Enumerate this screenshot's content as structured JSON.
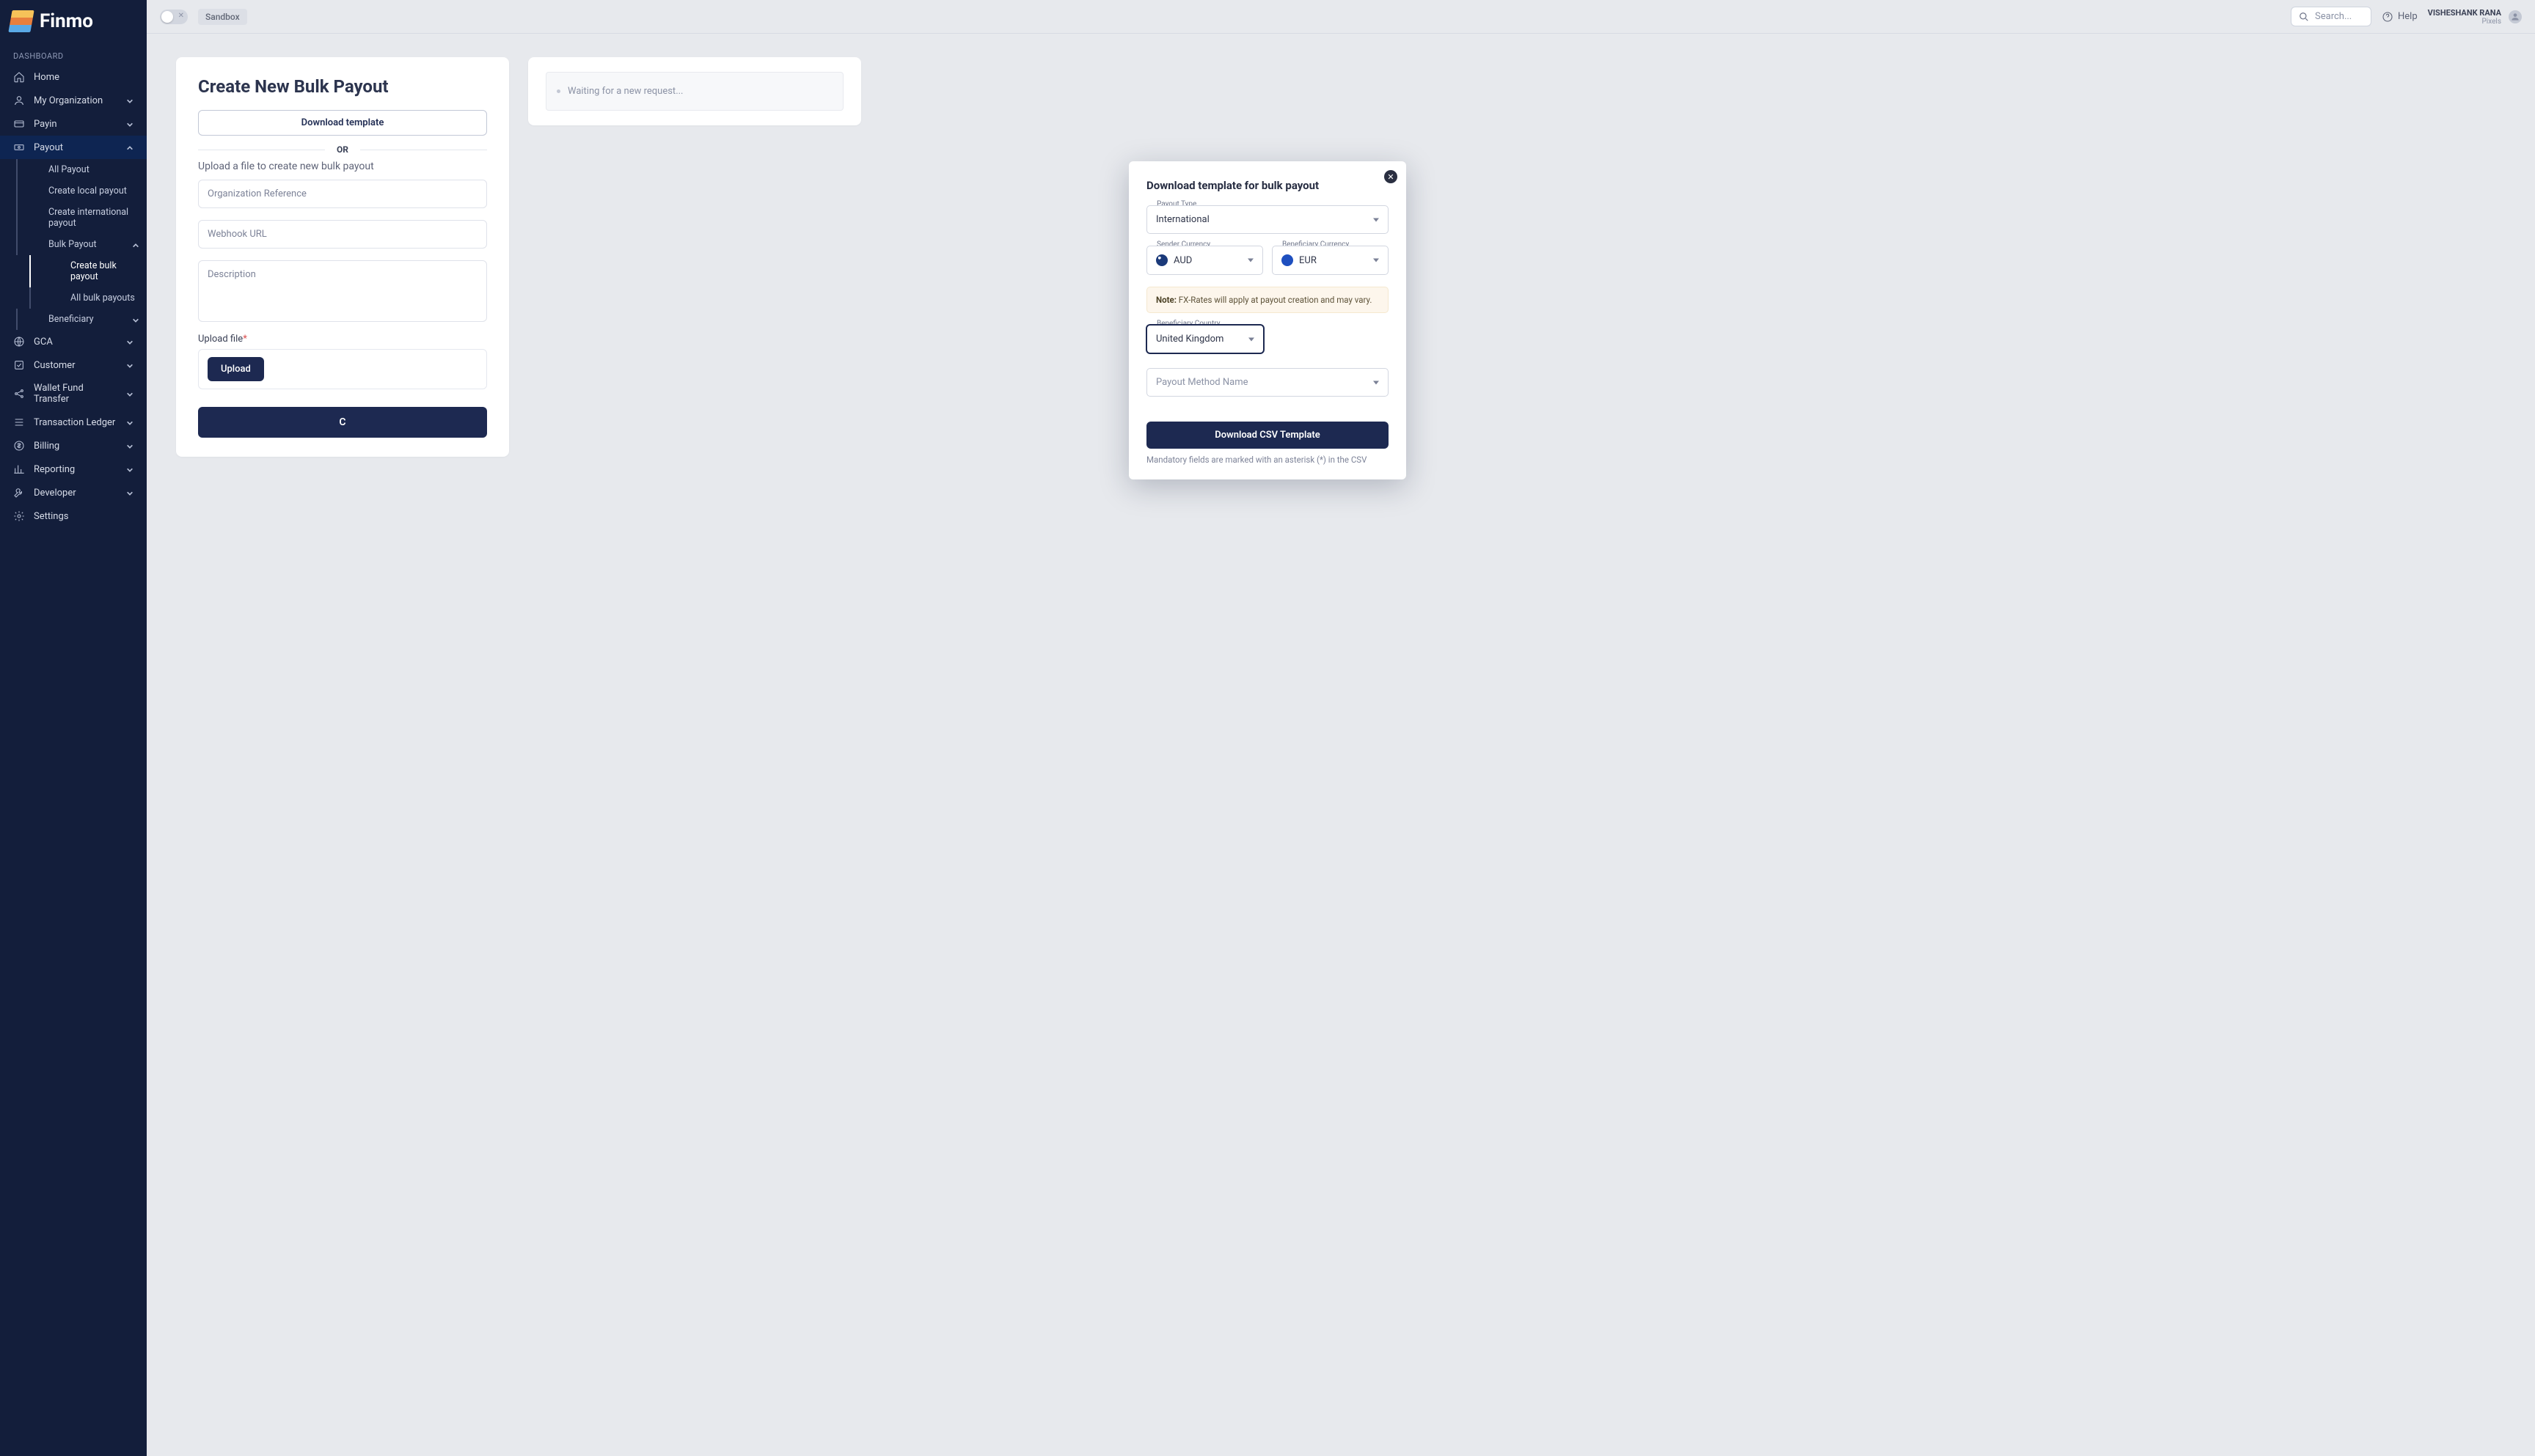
{
  "brand": "Finmo",
  "topbar": {
    "env_tag": "Sandbox",
    "search_placeholder": "Search...",
    "help_label": "Help",
    "user_name": "VISHESHANK RANA",
    "user_org": "Pixels"
  },
  "sidebar": {
    "section_label": "DASHBOARD",
    "items": {
      "home": "Home",
      "my_org": "My Organization",
      "payin": "Payin",
      "payout": "Payout",
      "gca": "GCA",
      "customer": "Customer",
      "wallet": "Wallet Fund Transfer",
      "ledger": "Transaction Ledger",
      "billing": "Billing",
      "reporting": "Reporting",
      "developer": "Developer",
      "settings": "Settings"
    },
    "payout_sub": {
      "all_payout": "All Payout",
      "create_local": "Create local payout",
      "create_intl": "Create international payout",
      "bulk_payout": "Bulk Payout",
      "create_bulk": "Create bulk payout",
      "all_bulk": "All bulk payouts",
      "beneficiary": "Beneficiary"
    }
  },
  "page": {
    "title": "Create New Bulk Payout",
    "download_template_btn": "Download template",
    "or_label": "OR",
    "upload_hint": "Upload a file to create new bulk payout",
    "org_ref_placeholder": "Organization Reference",
    "webhook_placeholder": "Webhook URL",
    "description_placeholder": "Description",
    "upload_file_label": "Upload file",
    "upload_btn": "Upload",
    "create_btn_partial": "C",
    "side_waiting": "Waiting for a new request..."
  },
  "modal": {
    "title": "Download template for bulk payout",
    "payout_type_label": "Payout Type",
    "payout_type_value": "International",
    "sender_currency_label": "Sender Currency",
    "sender_currency_value": "AUD",
    "beneficiary_currency_label": "Beneficiary Currency",
    "beneficiary_currency_value": "EUR",
    "note_prefix": "Note:",
    "note_text": " FX-Rates will apply at payout creation and may vary.",
    "beneficiary_country_label": "Beneficiary Country",
    "beneficiary_country_value": "United Kingdom",
    "payout_method_placeholder": "Payout Method Name",
    "download_btn": "Download CSV Template",
    "footer": "Mandatory fields are marked with an asterisk (*) in the CSV"
  }
}
